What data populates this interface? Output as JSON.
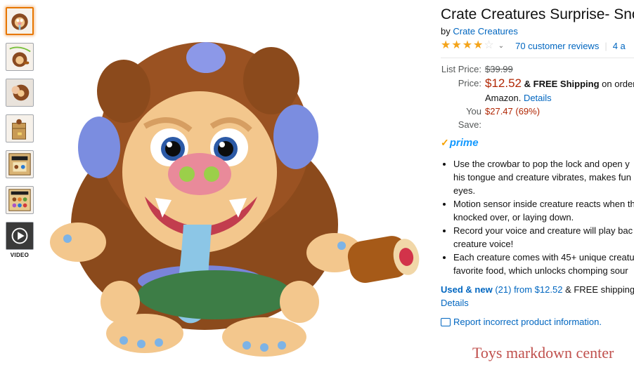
{
  "thumbnails": [
    {
      "name": "thumb-1",
      "active": true
    },
    {
      "name": "thumb-2",
      "active": false
    },
    {
      "name": "thumb-3",
      "active": false
    },
    {
      "name": "thumb-4",
      "active": false
    },
    {
      "name": "thumb-5",
      "active": false
    },
    {
      "name": "thumb-6",
      "active": false
    }
  ],
  "video_label": "VIDEO",
  "product": {
    "title": "Crate Creatures Surprise- Snort",
    "by_prefix": "by",
    "brand": "Crate Creatures",
    "rating": 4.0,
    "reviews": "70 customer reviews",
    "answered": "4 a"
  },
  "pricing": {
    "list_label": "List Price:",
    "list_price": "$39.99",
    "price_label": "Price:",
    "price": "$12.52",
    "shipping": "& FREE Shipping",
    "shipping_tail": "on order",
    "shipping_line2": "Amazon.",
    "details_link": "Details",
    "save_label": "You Save:",
    "save_value": "$27.47 (69%)"
  },
  "prime_label": "prime",
  "bullets": [
    [
      "Use the crowbar to pop the lock and open y",
      "his tongue and creature vibrates, makes fun",
      "eyes."
    ],
    [
      "Motion sensor inside creature reacts when th",
      "knocked over, or laying down."
    ],
    [
      "Record your voice and creature will play bac",
      "creature voice!"
    ],
    [
      "Each creature comes with 45+ unique creatu",
      "favorite food, which unlocks chomping sour"
    ]
  ],
  "used": {
    "label": "Used & new",
    "count": "(21)",
    "from": "from $12.52",
    "shipping": "& FREE shipping",
    "details": "Details"
  },
  "report_link": "Report incorrect product information.",
  "watermark": "Toys markdown center",
  "colors": {
    "link": "#0066c0",
    "price": "#b12704",
    "star": "#f4a41a",
    "prime": "#1399ff",
    "watermark": "#c0504d"
  }
}
